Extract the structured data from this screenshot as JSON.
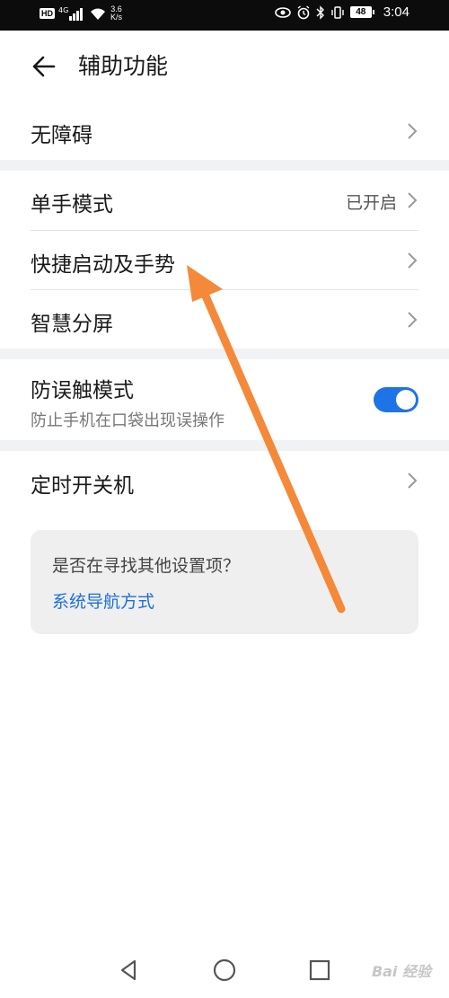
{
  "status_bar": {
    "hd": "HD",
    "signal_label": "4G",
    "net_speed_value": "3.6",
    "net_speed_unit": "K/s",
    "battery": "48",
    "time": "3:04"
  },
  "header": {
    "title": "辅助功能"
  },
  "items": {
    "accessibility": {
      "label": "无障碍"
    },
    "one_hand": {
      "label": "单手模式",
      "value": "已开启"
    },
    "shortcuts": {
      "label": "快捷启动及手势"
    },
    "split_screen": {
      "label": "智慧分屏"
    },
    "pocket_mode": {
      "label": "防误触模式",
      "sub": "防止手机在口袋出现误操作",
      "enabled": true
    },
    "schedule_power": {
      "label": "定时开关机"
    }
  },
  "suggest": {
    "question": "是否在寻找其他设置项？",
    "link": "系统导航方式"
  },
  "colors": {
    "accent": "#1e73e6",
    "annotation_arrow": "#f5893a"
  },
  "watermark": "Bai 经验"
}
